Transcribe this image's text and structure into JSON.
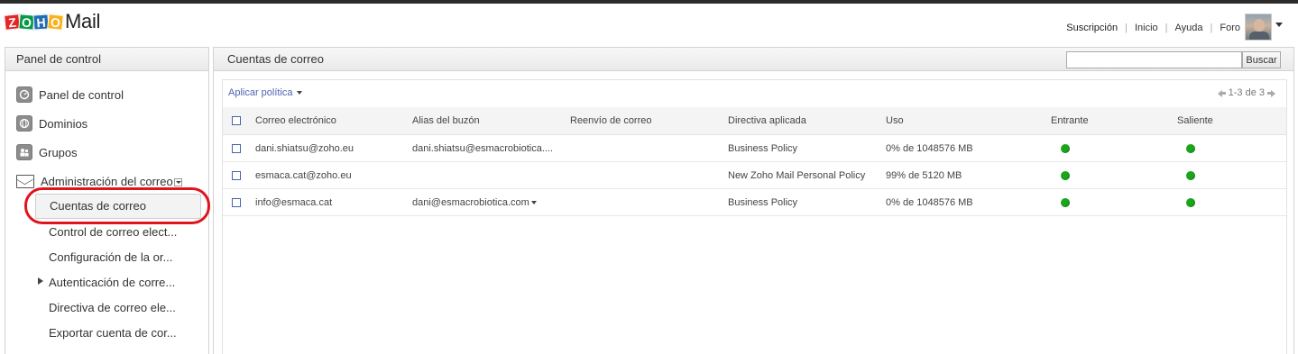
{
  "header": {
    "logo_letters": [
      "Z",
      "O",
      "H",
      "O"
    ],
    "logo_text": "Mail",
    "nav": [
      "Suscripción",
      "Inicio",
      "Ayuda",
      "Foro"
    ]
  },
  "sidebar": {
    "title": "Panel de control",
    "items": [
      {
        "label": "Panel de control",
        "icon": "dashboard-icon"
      },
      {
        "label": "Dominios",
        "icon": "globe-icon"
      },
      {
        "label": "Grupos",
        "icon": "group-icon"
      },
      {
        "label": "Administración del correo",
        "icon": "mail-icon"
      }
    ],
    "sub_items": [
      "Cuentas de correo",
      "Control de correo elect...",
      "Configuración de la or...",
      "Autenticación de corre...",
      "Directiva de correo ele...",
      "Exportar cuenta de cor..."
    ]
  },
  "main": {
    "title": "Cuentas de correo",
    "search_placeholder": "",
    "search_button": "Buscar",
    "apply_policy": "Aplicar política",
    "pager": "1-3 de 3",
    "columns": [
      "Correo electrónico",
      "Alias del buzón",
      "Reenvío de correo",
      "Directiva aplicada",
      "Uso",
      "Entrante",
      "Saliente"
    ],
    "rows": [
      {
        "email": "dani.shiatsu@zoho.eu",
        "alias": "dani.shiatsu@esmacrobiotica....",
        "forward": "",
        "policy": "Business Policy",
        "usage": "0% de 1048576 MB",
        "incoming": "enabled",
        "outgoing": "enabled"
      },
      {
        "email": "esmaca.cat@zoho.eu",
        "alias": "",
        "forward": "",
        "policy": "New Zoho Mail Personal Policy",
        "usage": "99% de 5120 MB",
        "incoming": "enabled",
        "outgoing": "enabled"
      },
      {
        "email": "info@esmaca.cat",
        "alias": "dani@esmacrobiotica.com",
        "forward": "",
        "policy": "Business Policy",
        "usage": "0% de 1048576 MB",
        "incoming": "enabled",
        "outgoing": "enabled"
      }
    ]
  },
  "colors": {
    "status_enabled": "#1aa51a",
    "highlight_ring": "#e0141b",
    "link": "#5064b4"
  }
}
